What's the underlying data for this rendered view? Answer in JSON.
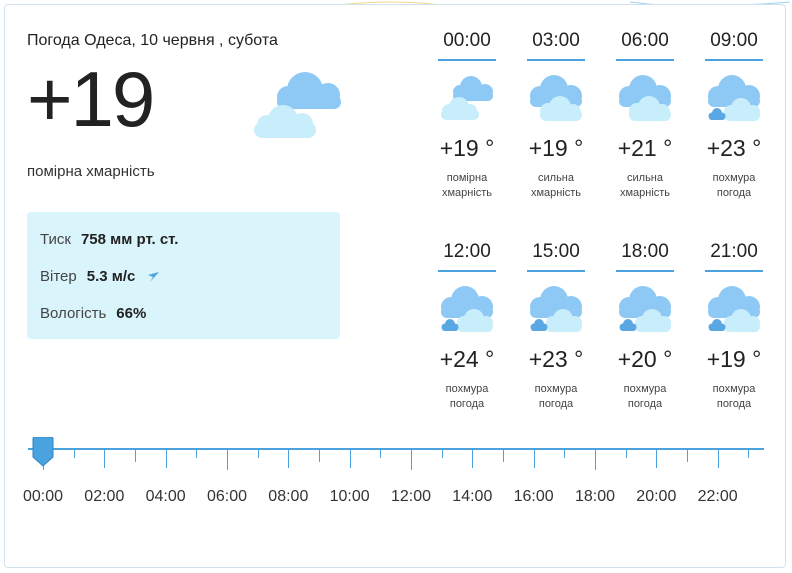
{
  "header": {
    "title": "Погода Одеса, 10 червня , субота"
  },
  "current": {
    "temperature": "+19",
    "condition": "помірна хмарність",
    "icon": "cloud-icon"
  },
  "details": {
    "pressure_label": "Тиск",
    "pressure_value": "758 мм рт. ст.",
    "wind_label": "Вітер",
    "wind_value": "5.3 м/с",
    "humidity_label": "Вологість",
    "humidity_value": "66%"
  },
  "forecast": [
    {
      "time": "00:00",
      "temp": "+19 °",
      "cond1": "помірна",
      "cond2": "хмарність",
      "icon": "partly-cloud-icon"
    },
    {
      "time": "03:00",
      "temp": "+19 °",
      "cond1": "сильна",
      "cond2": "хмарність",
      "icon": "cloud-icon"
    },
    {
      "time": "06:00",
      "temp": "+21 °",
      "cond1": "сильна",
      "cond2": "хмарність",
      "icon": "cloud-icon"
    },
    {
      "time": "09:00",
      "temp": "+23 °",
      "cond1": "похмура",
      "cond2": "погода",
      "icon": "overcast-icon"
    },
    {
      "time": "12:00",
      "temp": "+24 °",
      "cond1": "похмура",
      "cond2": "погода",
      "icon": "overcast-icon"
    },
    {
      "time": "15:00",
      "temp": "+23 °",
      "cond1": "похмура",
      "cond2": "погода",
      "icon": "overcast-icon"
    },
    {
      "time": "18:00",
      "temp": "+20 °",
      "cond1": "похмура",
      "cond2": "погода",
      "icon": "overcast-icon"
    },
    {
      "time": "21:00",
      "temp": "+19 °",
      "cond1": "похмура",
      "cond2": "погода",
      "icon": "overcast-icon"
    }
  ],
  "timeline": {
    "labels": [
      "00:00",
      "02:00",
      "04:00",
      "06:00",
      "08:00",
      "10:00",
      "12:00",
      "14:00",
      "16:00",
      "18:00",
      "20:00",
      "22:00"
    ],
    "selected": "00:00"
  },
  "colors": {
    "accent": "#4aa3df",
    "cloud_dark": "#8ec9f5",
    "cloud_light": "#c8eefc",
    "panel": "#d9f4fb"
  }
}
